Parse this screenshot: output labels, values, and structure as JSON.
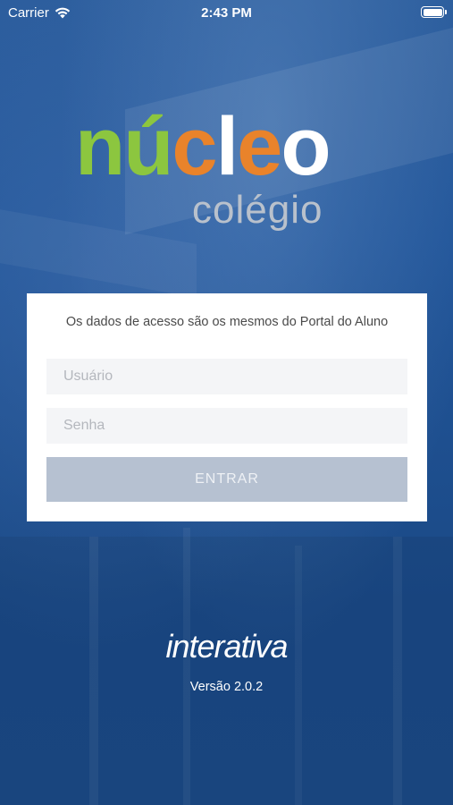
{
  "status_bar": {
    "carrier": "Carrier",
    "time": "2:43 PM",
    "wifi_icon": "wifi-icon",
    "battery_icon": "battery-icon"
  },
  "logo": {
    "letters": [
      {
        "char": "n",
        "color": "#8cc63f"
      },
      {
        "char": "ú",
        "color": "#8cc63f"
      },
      {
        "char": "c",
        "color": "#e9832b"
      },
      {
        "char": "l",
        "color": "#ffffff"
      },
      {
        "char": "e",
        "color": "#e9832b"
      },
      {
        "char": "o",
        "color": "#ffffff"
      }
    ],
    "subtitle": "colégio"
  },
  "login": {
    "notice": "Os dados de acesso são os mesmos do Portal do Aluno",
    "username_placeholder": "Usuário",
    "username_value": "",
    "password_placeholder": "Senha",
    "password_value": "",
    "submit_label": "ENTRAR"
  },
  "footer": {
    "brand": "interativa",
    "version": "Versão 2.0.2"
  },
  "colors": {
    "background": "#1d4f8f",
    "button_disabled": "#b6c1d1",
    "green": "#8cc63f",
    "orange": "#e9832b"
  }
}
